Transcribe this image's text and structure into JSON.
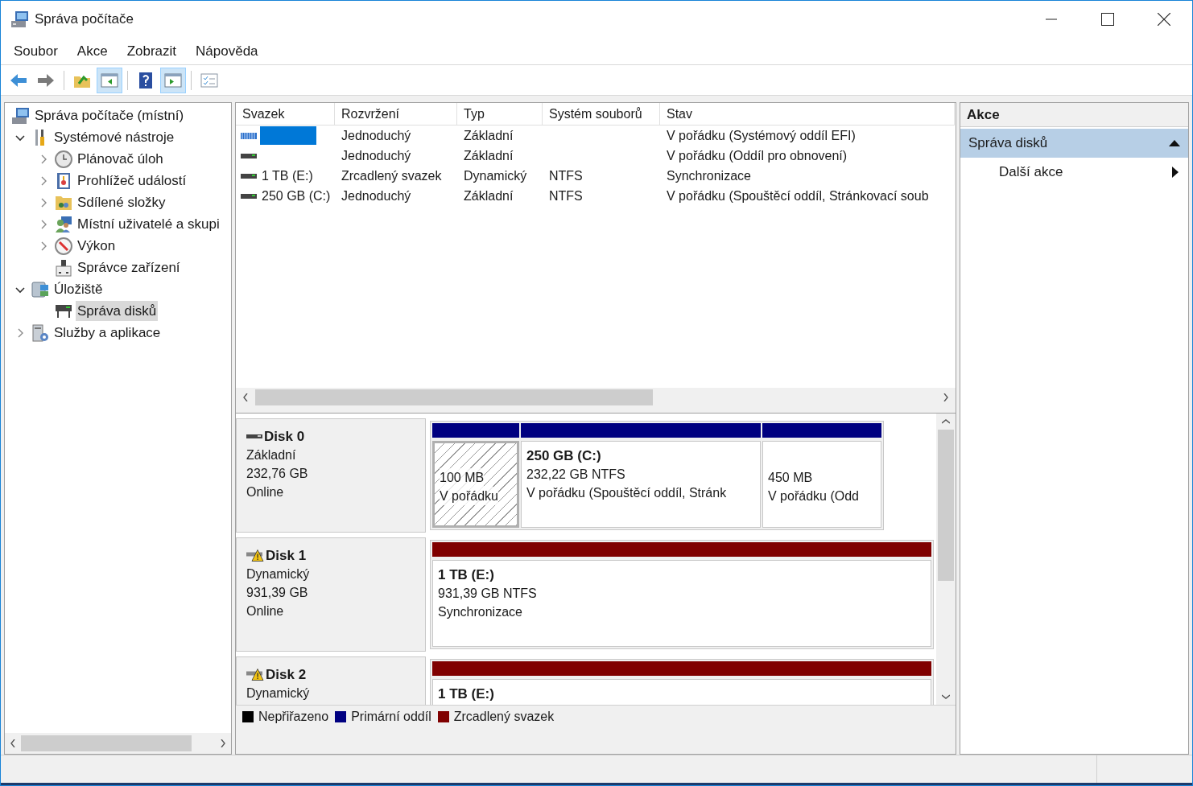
{
  "window": {
    "title": "Správa počítače"
  },
  "menu": [
    "Soubor",
    "Akce",
    "Zobrazit",
    "Nápověda"
  ],
  "toolbar": [
    {
      "kind": "back",
      "pressed": false
    },
    {
      "kind": "forward",
      "pressed": false
    },
    {
      "kind": "sep"
    },
    {
      "kind": "up",
      "pressed": false
    },
    {
      "kind": "tree",
      "pressed": true
    },
    {
      "kind": "sep"
    },
    {
      "kind": "help",
      "pressed": false
    },
    {
      "kind": "pane",
      "pressed": true
    },
    {
      "kind": "sep"
    },
    {
      "kind": "props",
      "pressed": false
    }
  ],
  "tree": [
    {
      "label": "Správa počítače (místní)",
      "selected": false,
      "children": [
        {
          "label": "Systémové nástroje",
          "expanded": true,
          "selected": false,
          "children": [
            {
              "label": "Plánovač úloh",
              "expanded": false,
              "selected": false
            },
            {
              "label": "Prohlížeč událostí",
              "expanded": false,
              "selected": false
            },
            {
              "label": "Sdílené složky",
              "expanded": false,
              "selected": false
            },
            {
              "label": "Místní uživatelé a skupi",
              "expanded": false,
              "selected": false
            },
            {
              "label": "Výkon",
              "expanded": false,
              "selected": false
            },
            {
              "label": "Správce zařízení",
              "selected": false
            }
          ]
        },
        {
          "label": "Úložiště",
          "expanded": true,
          "selected": false,
          "children": [
            {
              "label": "Správa disků",
              "selected": true
            }
          ]
        },
        {
          "label": "Služby a aplikace",
          "expanded": false,
          "selected": false
        }
      ]
    }
  ],
  "volumes": {
    "columns": [
      "Svazek",
      "Rozvržení",
      "Typ",
      "Systém souborů",
      "Stav"
    ],
    "rows": [
      {
        "kind": "efi",
        "selected": true,
        "cells": [
          "",
          "Jednoduchý",
          "Základní",
          "",
          "V pořádku (Systémový oddíl EFI)"
        ]
      },
      {
        "kind": "drive",
        "selected": false,
        "cells": [
          "",
          "Jednoduchý",
          "Základní",
          "",
          "V pořádku (Oddíl pro obnovení)"
        ]
      },
      {
        "kind": "drive",
        "selected": false,
        "cells": [
          "1 TB (E:)",
          "Zrcadlený svazek",
          "Dynamický",
          "NTFS",
          "Synchronizace"
        ]
      },
      {
        "kind": "drive",
        "selected": false,
        "cells": [
          "250 GB (C:)",
          "Jednoduchý",
          "Základní",
          "NTFS",
          "V pořádku (Spouštěcí oddíl, Stránkovací soub"
        ]
      }
    ]
  },
  "disks": [
    {
      "name": "Disk 0",
      "warning": false,
      "lines": [
        "Základní",
        "232,76 GB",
        "Online"
      ],
      "partitions": [
        {
          "color": "#000080",
          "selected": true,
          "lines": [
            "100 MB",
            "V pořádku"
          ]
        },
        {
          "color": "#000080",
          "selected": false,
          "title": "250 GB  (C:)",
          "lines": [
            "232,22 GB NTFS",
            "V pořádku (Spouštěcí oddíl, Stránk"
          ]
        },
        {
          "color": "#000080",
          "selected": false,
          "lines": [
            "450 MB",
            "V pořádku (Odd"
          ]
        }
      ]
    },
    {
      "name": "Disk 1",
      "warning": true,
      "lines": [
        "Dynamický",
        "931,39 GB",
        "Online"
      ],
      "partitions": [
        {
          "color": "#800000",
          "selected": false,
          "title": "1 TB  (E:)",
          "lines": [
            "931,39 GB NTFS",
            "Synchronizace"
          ]
        }
      ]
    },
    {
      "name": "Disk 2",
      "warning": true,
      "lines": [
        "Dynamický"
      ],
      "partitions": [
        {
          "color": "#800000",
          "selected": false,
          "title": "1 TB  (E:)"
        }
      ]
    }
  ],
  "legend": [
    {
      "label": "Nepřiřazeno",
      "color": "#000000"
    },
    {
      "label": "Primární oddíl",
      "color": "#000080"
    },
    {
      "label": "Zrcadlený svazek",
      "color": "#800000"
    }
  ],
  "actions": {
    "title": "Akce",
    "sections": [
      {
        "label": "Správa disků",
        "expanded": true,
        "items": [
          "Další akce"
        ]
      }
    ]
  }
}
